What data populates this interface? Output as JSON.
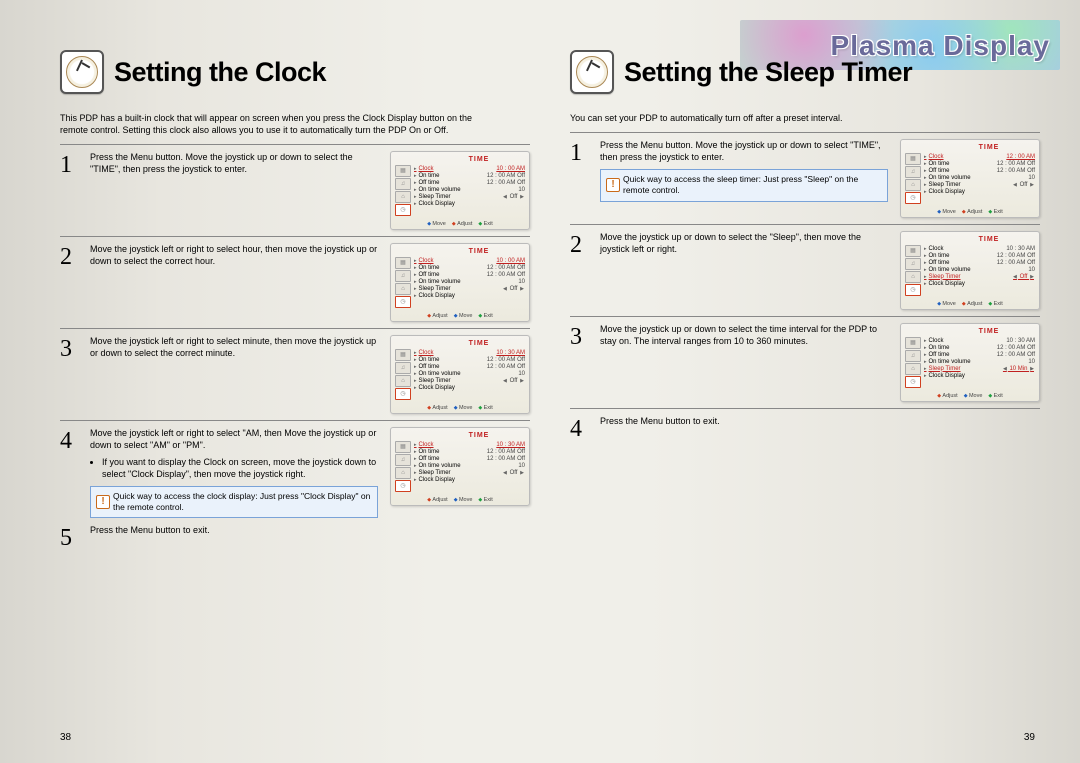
{
  "brand": "Plasma Display",
  "left": {
    "title": "Setting the Clock",
    "intro": "This PDP has a built-in clock that will appear on screen when you press the Clock Display button on the remote control. Setting this clock also allows you to use it to automatically turn the PDP On or Off.",
    "steps": [
      {
        "num": "1",
        "text": "Press the Menu button. Move the joystick up or down to select the \"TIME\", then press the joystick to enter."
      },
      {
        "num": "2",
        "text": "Move the joystick left or right to select  hour, then move the joystick up or down to select the correct hour."
      },
      {
        "num": "3",
        "text": "Move the joystick left or right to select  minute, then move the joystick up or down to select the correct minute."
      },
      {
        "num": "4",
        "text": "Move the joystick left or right to select  \"AM, then Move the joystick up or down to select \"AM\" or \"PM\".",
        "bullets": [
          "If you want to display the Clock on screen, move the joystick down to select \"Clock Display\", then move the joystick right."
        ],
        "tip": "Quick way to access the clock display: Just press \"Clock Display\" on the remote control."
      },
      {
        "num": "5",
        "text": "Press the Menu button to exit."
      }
    ],
    "page": "38"
  },
  "right": {
    "title": "Setting the Sleep Timer",
    "intro": "You can set your PDP to automatically turn off after a preset interval.",
    "steps": [
      {
        "num": "1",
        "text": "Press the Menu button. Move the joystick up or down to select \"TIME\", then press the joystick to enter.",
        "tip": "Quick way to access the sleep timer: Just press \"Sleep\" on the remote control."
      },
      {
        "num": "2",
        "text": "Move the joystick up or down to select the \"Sleep\", then move the joystick left or right."
      },
      {
        "num": "3",
        "text": "Move the joystick up or down to select the time interval for the PDP to stay on.  The interval ranges from 10 to 360 minutes."
      },
      {
        "num": "4",
        "text": "Press the Menu button to exit."
      }
    ],
    "page": "39"
  },
  "menu": {
    "title": "TIME",
    "foot": {
      "adjust": "Adjust",
      "move": "Move",
      "exit": "Exit"
    },
    "shot_l1": {
      "hl": 0,
      "clock": "10 : 00 AM",
      "sleep": "Off",
      "foot_order": [
        "move",
        "adjust",
        "exit"
      ]
    },
    "shot_l2": {
      "hl": 0,
      "clock": "10 : 00 AM",
      "sleep": "Off",
      "foot_order": [
        "adjust",
        "move",
        "exit"
      ]
    },
    "shot_l3": {
      "hl": 0,
      "clock": "10 : 30 AM",
      "sleep": "Off",
      "foot_order": [
        "adjust",
        "move",
        "exit"
      ]
    },
    "shot_l4": {
      "hl": 0,
      "clock": "10 : 30 AM",
      "sleep": "Off",
      "foot_order": [
        "adjust",
        "move",
        "exit"
      ]
    },
    "shot_r1": {
      "hl": 0,
      "clock": "12 : 00 AM",
      "sleep": "Off",
      "foot_order": [
        "move",
        "adjust",
        "exit"
      ]
    },
    "shot_r2": {
      "hl": 4,
      "clock": "10 : 30 AM",
      "sleep": "Off",
      "foot_order": [
        "move",
        "adjust",
        "exit"
      ]
    },
    "shot_r3": {
      "hl": 4,
      "clock": "10 : 30 AM",
      "sleep": "10 Min",
      "foot_order": [
        "adjust",
        "move",
        "exit"
      ]
    },
    "rows_base": [
      {
        "lbl": "Clock",
        "val": ""
      },
      {
        "lbl": "On time",
        "val": "12 : 00 AM Off"
      },
      {
        "lbl": "Off time",
        "val": "12 : 00 AM Off"
      },
      {
        "lbl": "On time volume",
        "val": "10"
      },
      {
        "lbl": "Sleep Timer",
        "val": ""
      },
      {
        "lbl": "Clock Display",
        "val": ""
      }
    ]
  }
}
